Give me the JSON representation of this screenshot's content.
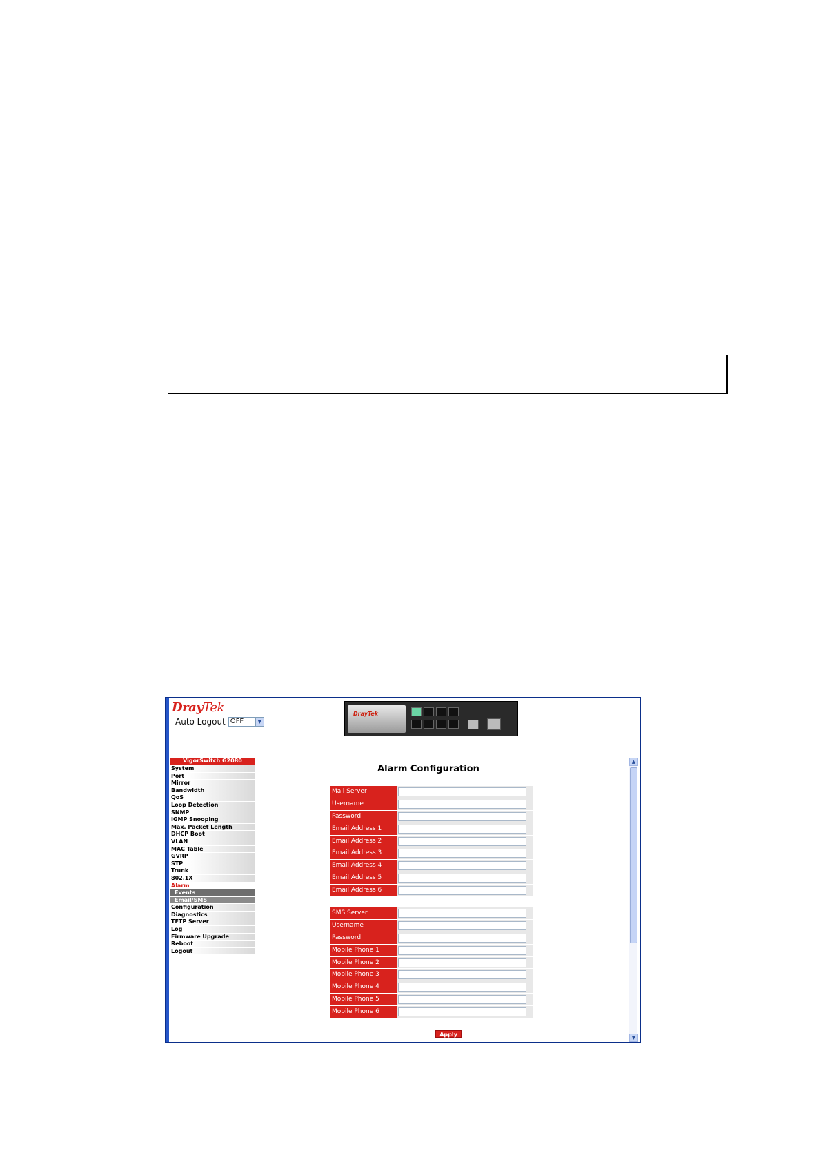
{
  "logo": {
    "part1": "Dray",
    "part2": "Tek"
  },
  "auto_logout": {
    "label": "Auto Logout",
    "value": "OFF"
  },
  "device": {
    "brand": "DrayTek"
  },
  "sidebar": {
    "header": "VigorSwitch G2080",
    "items_before": [
      "System",
      "Port",
      "Mirror",
      "Bandwidth",
      "QoS",
      "Loop Detection",
      "SNMP",
      "IGMP Snooping",
      "Max. Packet Length",
      "DHCP Boot",
      "VLAN",
      "MAC Table",
      "GVRP",
      "STP",
      "Trunk",
      "802.1X"
    ],
    "active": "Alarm",
    "subitems": [
      "Events",
      "Email/SMS"
    ],
    "items_after": [
      "Configuration",
      "Diagnostics",
      "TFTP Server",
      "Log",
      "Firmware Upgrade",
      "Reboot",
      "Logout"
    ]
  },
  "main": {
    "title": "Alarm Configuration",
    "email_fields": [
      "Mail Server",
      "Username",
      "Password",
      "Email Address 1",
      "Email Address 2",
      "Email Address 3",
      "Email Address 4",
      "Email Address 5",
      "Email Address 6"
    ],
    "sms_fields": [
      "SMS Server",
      "Username",
      "Password",
      "Mobile Phone 1",
      "Mobile Phone 2",
      "Mobile Phone 3",
      "Mobile Phone 4",
      "Mobile Phone 5",
      "Mobile Phone 6"
    ],
    "apply_label": "Apply"
  },
  "colors": {
    "accent": "#d8221d",
    "frame": "#0b2f8a"
  }
}
